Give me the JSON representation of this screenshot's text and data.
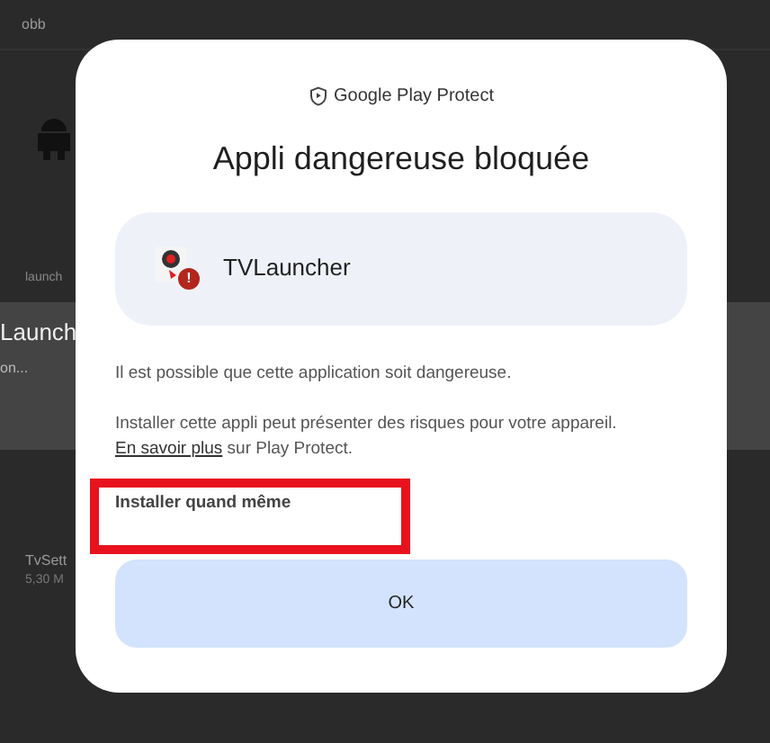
{
  "background": {
    "folder": "obb",
    "list_label": "launch",
    "app_title": "Launch",
    "app_subtitle": "on...",
    "next_app": {
      "name": "TvSett",
      "size": "5,30 M"
    }
  },
  "dialog": {
    "source": "Google Play Protect",
    "title": "Appli dangereuse bloquée",
    "app": {
      "name": "TVLauncher",
      "badge": "!"
    },
    "message": "Il est possible que cette application soit dangereuse.",
    "details": "Installer cette appli peut présenter des risques pour votre appareil. ",
    "link": "En savoir plus",
    "details_end": " sur Play Protect.",
    "secondary_action": {
      "label": "Installer quand même",
      "highlighted": true
    },
    "primary_action": "OK"
  }
}
